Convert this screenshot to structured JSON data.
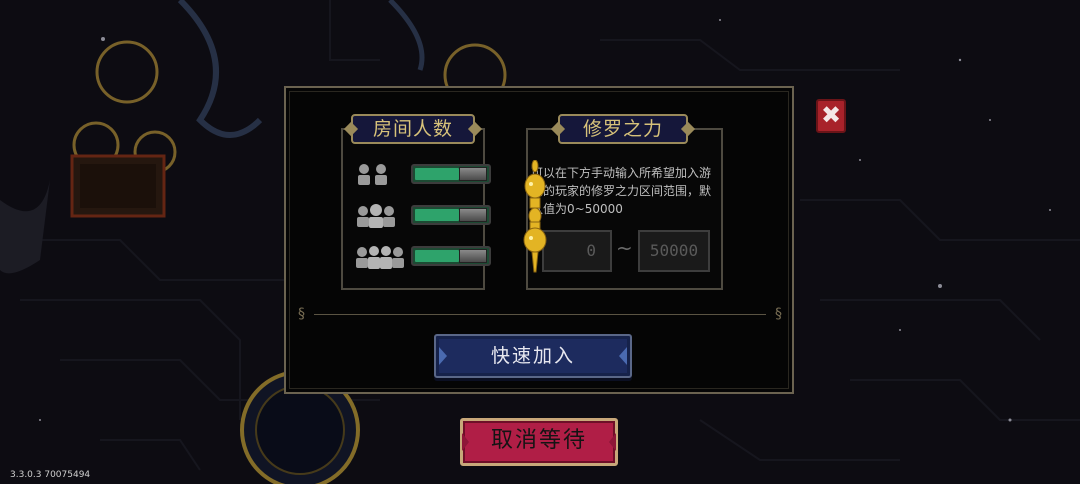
{
  "colors": {
    "panel_bg": "#050505",
    "panel_border": "#6b6350",
    "banner_bg": "#15173a",
    "banner_text": "#d7c27a",
    "toggle_on": "#2ea36b",
    "quick_join_bg": "#1d2b5e",
    "cancel_bg": "#b01e46",
    "close_bg": "#a8222a"
  },
  "room_size": {
    "title": "房间人数",
    "options": [
      {
        "icon": "two-players-icon",
        "enabled": true
      },
      {
        "icon": "three-players-icon",
        "enabled": true
      },
      {
        "icon": "four-players-icon",
        "enabled": true
      }
    ]
  },
  "asura_power": {
    "title": "修罗之力",
    "description": "可以在下方手动输入所希望加入游戏的玩家的修罗之力区间范围，默认值为0~50000",
    "min_value": "0",
    "separator": "~",
    "max_value": "50000"
  },
  "buttons": {
    "quick_join": "快速加入",
    "cancel_wait": "取消等待",
    "close": "✖"
  },
  "version": "3.3.0.3 70075494"
}
